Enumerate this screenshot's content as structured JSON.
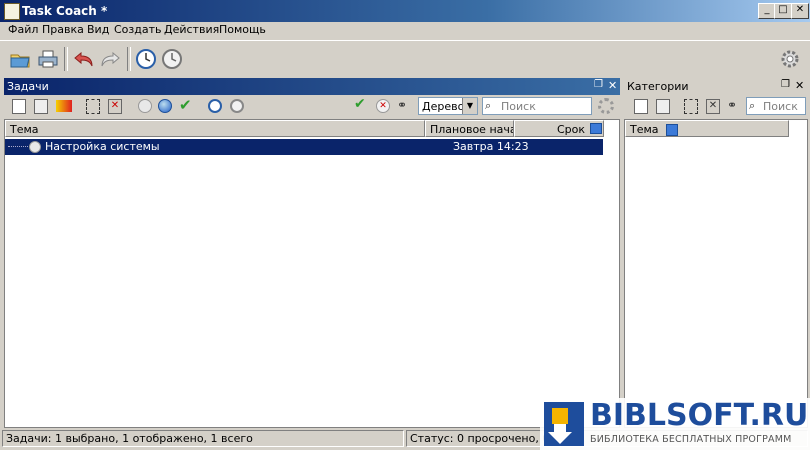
{
  "window": {
    "title": "Task Coach *"
  },
  "menu": [
    "Файл",
    "Правка",
    "Вид",
    "Создать",
    "Действия",
    "Помощь"
  ],
  "tasks_panel": {
    "title": "Задачи",
    "view_mode": "Дерево",
    "search_placeholder": "Поиск",
    "columns": {
      "subject": "Тема",
      "planned_start": "Плановое нача...",
      "due": "Срок"
    },
    "rows": [
      {
        "subject": "Настройка системы",
        "planned_start": "Завтра 14:23",
        "due": ""
      }
    ]
  },
  "categories_panel": {
    "title": "Категории",
    "search_placeholder": "Поиск",
    "columns": {
      "subject": "Тема"
    }
  },
  "status": {
    "left": "Задачи: 1 выбрано, 1 отображено, 1 всего",
    "right": "Статус: 0 просрочено, 0 уста"
  },
  "watermark": {
    "brand": "BIBLSOFT.RU",
    "tagline": "БИБЛИОТЕКА БЕСПЛАТНЫХ ПРОГРАММ"
  },
  "colors": {
    "title_bar": "#0a246a",
    "selection": "#0a246a",
    "accent": "#1e4d9c"
  }
}
